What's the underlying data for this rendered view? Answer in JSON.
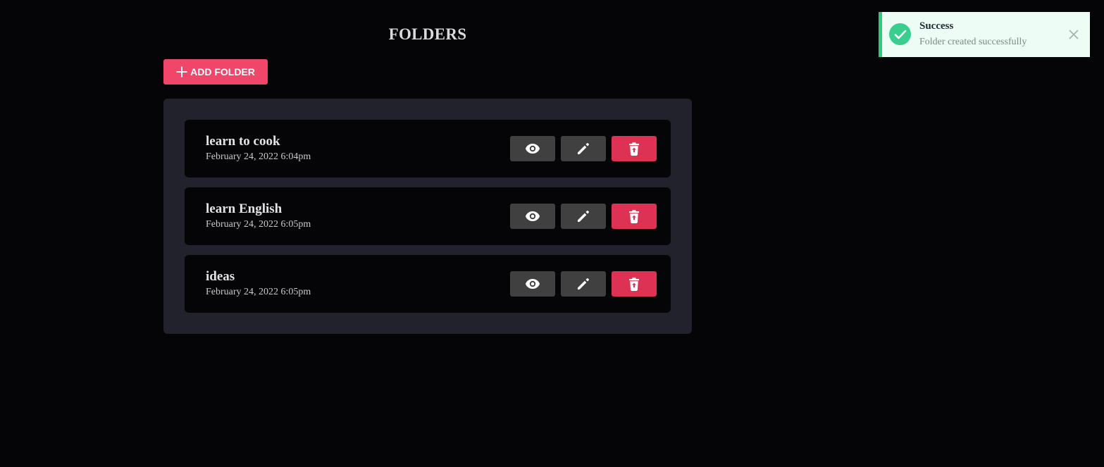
{
  "header": {
    "title": "FOLDERS"
  },
  "toolbar": {
    "add_label": "ADD FOLDER",
    "add_icon": "plus-icon"
  },
  "folders": [
    {
      "name": "learn to cook",
      "date": "February 24, 2022 6:04pm"
    },
    {
      "name": "learn English",
      "date": "February 24, 2022 6:05pm"
    },
    {
      "name": "ideas",
      "date": "February 24, 2022 6:05pm"
    }
  ],
  "actions": {
    "view_icon": "eye-icon",
    "edit_icon": "pencil-icon",
    "delete_icon": "trash-icon"
  },
  "toast": {
    "title": "Success",
    "message": "Folder created successfully",
    "status_icon": "check-icon",
    "close_icon": "close-icon"
  },
  "colors": {
    "background": "#050507",
    "panel": "#22222d",
    "accent": "#f0466a",
    "delete": "#dd3253",
    "action_button": "#404041",
    "toast_background": "#edfcf4",
    "toast_accent": "#32c880"
  }
}
